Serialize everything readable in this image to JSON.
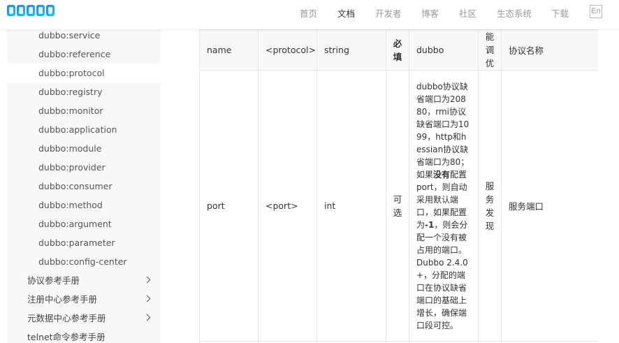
{
  "header": {
    "nav": [
      {
        "label": "首页",
        "active": false
      },
      {
        "label": "文档",
        "active": true
      },
      {
        "label": "开发者",
        "active": false
      },
      {
        "label": "博客",
        "active": false
      },
      {
        "label": "社区",
        "active": false
      },
      {
        "label": "生态系统",
        "active": false
      },
      {
        "label": "下载",
        "active": false
      }
    ],
    "lang": "En"
  },
  "sidebar": {
    "sub_items": [
      "dubbo:service",
      "dubbo:reference",
      "dubbo:protocol",
      "dubbo:registry",
      "dubbo:monitor",
      "dubbo:application",
      "dubbo:module",
      "dubbo:provider",
      "dubbo:consumer",
      "dubbo:method",
      "dubbo:argument",
      "dubbo:parameter",
      "dubbo:config-center"
    ],
    "active": "dubbo:protocol",
    "top_items": [
      "协议参考手册",
      "注册中心参考手册",
      "元数据中心参考手册",
      "telnet命令参考手册"
    ]
  },
  "table": {
    "headers": [
      "name",
      "<protocol>",
      "string",
      "必填",
      "dubbo",
      "能调优",
      "协议名称"
    ],
    "row": {
      "attr": "port",
      "tag": "<port>",
      "type": "int",
      "required": "可选",
      "default_pre": "dubbo协议缺省端口为20880，rmi协议缺省端口为1099，http和hessian协议缺省端口为80；如果",
      "default_bold1": "没有",
      "default_mid": "配置port，则自动采用默认端口，如果配置为",
      "default_bold2": "-1",
      "default_post": "，则会分配一个没有被占用的端口。Dubbo 2.4.0+，分配的端口在协议缺省端口的基础上增长，确保端口段可控。",
      "tuning": "服务发现",
      "description": "服务端口"
    }
  },
  "colors": {
    "accent": "#2db7f5",
    "sidebar_bg": "#f8f8f8",
    "nav_inactive": "#999999"
  }
}
